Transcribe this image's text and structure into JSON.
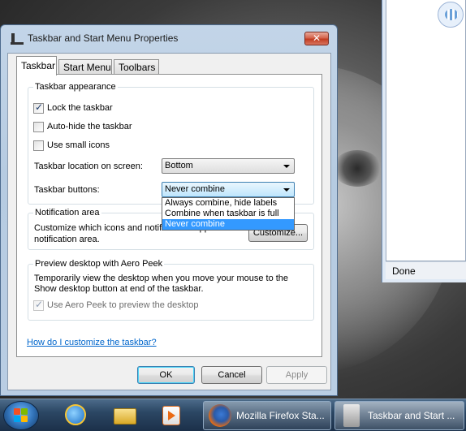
{
  "browser": {
    "status_text": "Done"
  },
  "dialog": {
    "title": "Taskbar and Start Menu Properties",
    "close_glyph": "✕",
    "tabs": [
      "Taskbar",
      "Start Menu",
      "Toolbars"
    ],
    "appearance": {
      "group_label": "Taskbar appearance",
      "lock_label": "Lock the taskbar",
      "lock_checked": true,
      "autohide_label": "Auto-hide the taskbar",
      "autohide_checked": false,
      "small_icons_label": "Use small icons",
      "small_icons_checked": false,
      "location_label": "Taskbar location on screen:",
      "location_value": "Bottom",
      "buttons_label": "Taskbar buttons:",
      "buttons_value": "Never combine",
      "buttons_options": [
        "Always combine, hide labels",
        "Combine when taskbar is full",
        "Never combine"
      ],
      "buttons_selected_index": 2
    },
    "notification": {
      "group_label": "Notification area",
      "description_line1": "Customize which icons and notifications appear in the",
      "description_line2": "notification area.",
      "customize_label": "Customize..."
    },
    "aero_peek": {
      "group_label": "Preview desktop with Aero Peek",
      "description_line1": "Temporarily view the desktop when you move your mouse to the",
      "description_line2": "Show desktop button at end of the taskbar.",
      "checkbox_label": "Use Aero Peek to preview the desktop",
      "checked": true,
      "disabled": true
    },
    "help_link": "How do I customize the taskbar?",
    "ok_label": "OK",
    "cancel_label": "Cancel",
    "apply_label": "Apply"
  },
  "taskbar": {
    "items": [
      {
        "label": "Mozilla Firefox Sta..."
      },
      {
        "label": "Taskbar and Start ..."
      }
    ]
  },
  "colors": {
    "accent": "#3399ff",
    "link": "#0066cc"
  }
}
